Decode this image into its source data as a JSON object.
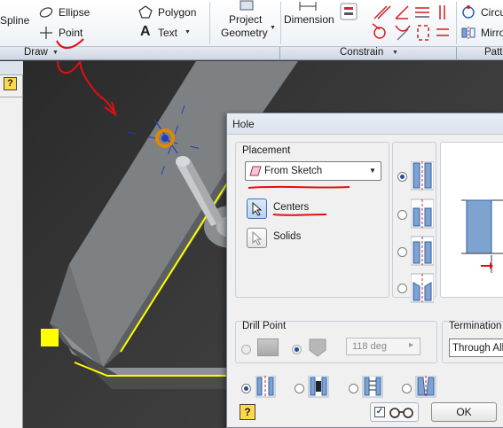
{
  "ribbon": {
    "spline_label": "Spline",
    "ellipse_label": "Ellipse",
    "point_label": "Point",
    "polygon_label": "Polygon",
    "text_label": "Text",
    "project_geometry_line1": "Project",
    "project_geometry_line2": "Geometry",
    "dimension_label": "Dimension",
    "circular_label": "Circu",
    "mirror_label": "Mirro",
    "draw_panel": "Draw",
    "constrain_panel": "Constrain",
    "pattern_panel": "Patt"
  },
  "browser": {
    "help_icon": "?"
  },
  "dialog": {
    "title": "Hole",
    "placement_label": "Placement",
    "placement_value": "From Sketch",
    "centers_label": "Centers",
    "solids_label": "Solids",
    "drill_point_label": "Drill Point",
    "drill_angle": "118 deg",
    "termination_label": "Termination",
    "termination_value": "Through All",
    "ok_label": "OK",
    "help_label": "?"
  },
  "colors": {
    "annotation_red": "#e01010",
    "sketch_yellow": "#ffff00",
    "selection_blue": "#1f4e9b"
  }
}
